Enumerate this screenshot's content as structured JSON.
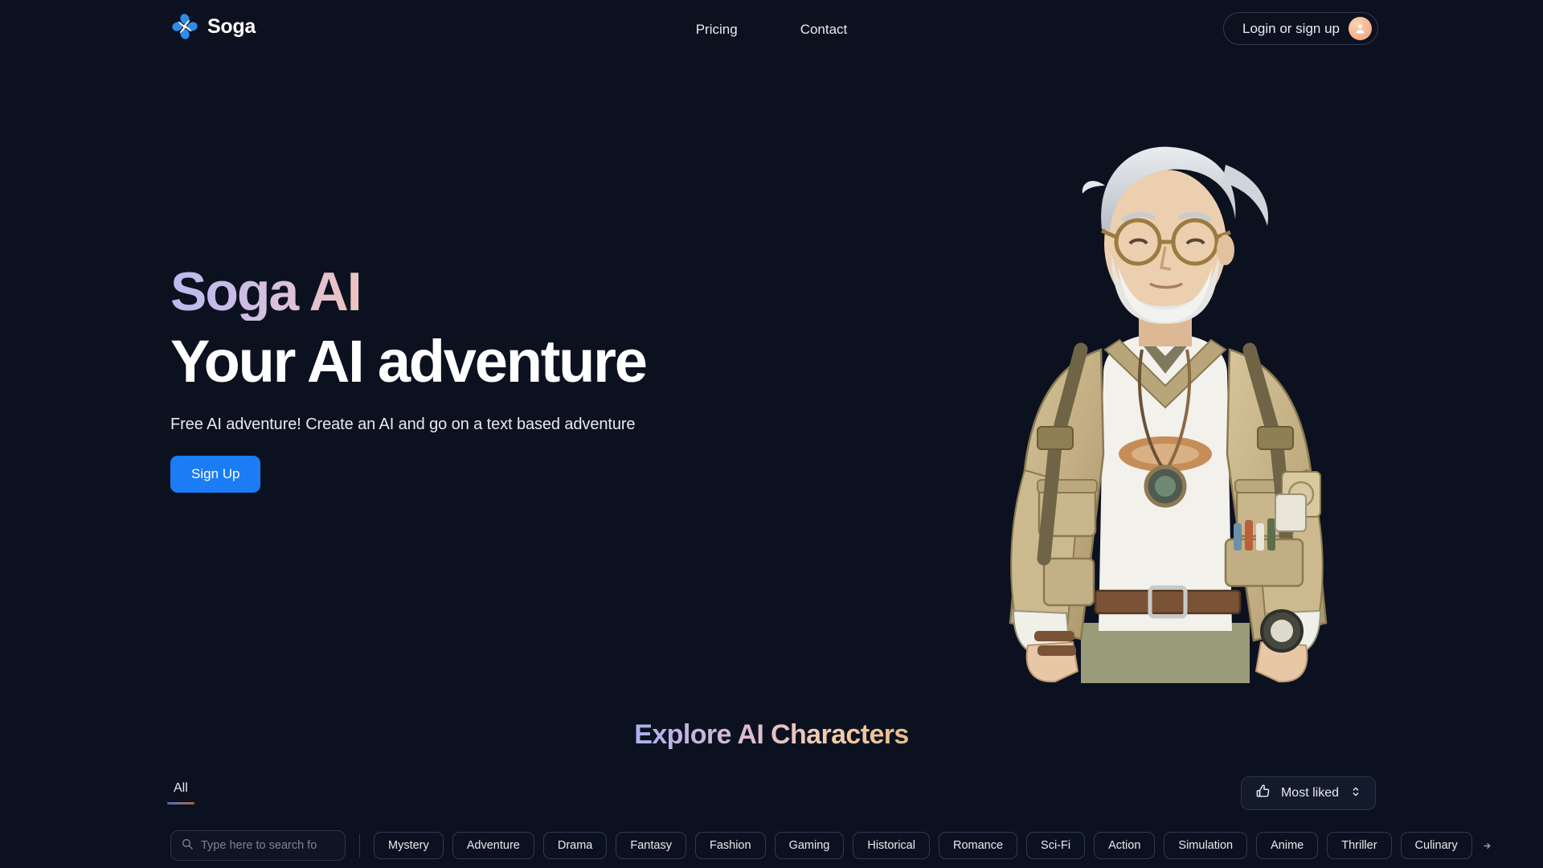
{
  "header": {
    "brand": "Soga",
    "logo_icon": "soga-flower-logo",
    "nav": [
      {
        "label": "Pricing"
      },
      {
        "label": "Contact"
      }
    ],
    "login": {
      "label": "Login or sign up",
      "avatar_icon": "user-avatar-icon",
      "avatar_color": "#f3b58f"
    }
  },
  "hero": {
    "eyebrow": "Soga AI",
    "title": "Your AI adventure",
    "subtitle": "Free AI adventure! Create an AI and go on a text based adventure",
    "cta_label": "Sign Up",
    "cta_color": "#1b7cf5",
    "artwork_alt": "Illustrated elderly adventurer with gray hair, round glasses, beard, khaki utility jacket and compass pendant"
  },
  "explore": {
    "title": "Explore AI Characters",
    "tabs": [
      {
        "label": "All",
        "active": true
      }
    ],
    "sort": {
      "icon": "thumbs-up-icon",
      "label": "Most liked",
      "chevron_icon": "chevron-up-down-icon"
    },
    "search": {
      "icon": "search-icon",
      "placeholder": "Type here to search fo",
      "value": ""
    },
    "categories": [
      "Mystery",
      "Adventure",
      "Drama",
      "Fantasy",
      "Fashion",
      "Gaming",
      "Historical",
      "Romance",
      "Sci-Fi",
      "Action",
      "Simulation",
      "Anime",
      "Thriller",
      "Culinary"
    ],
    "scroll_arrow_icon": "arrow-right-icon"
  },
  "theme": {
    "background": "#0c1120",
    "accent_blue": "#1b7cf5",
    "border": "#2c3547",
    "text": "#e8eaf0"
  }
}
